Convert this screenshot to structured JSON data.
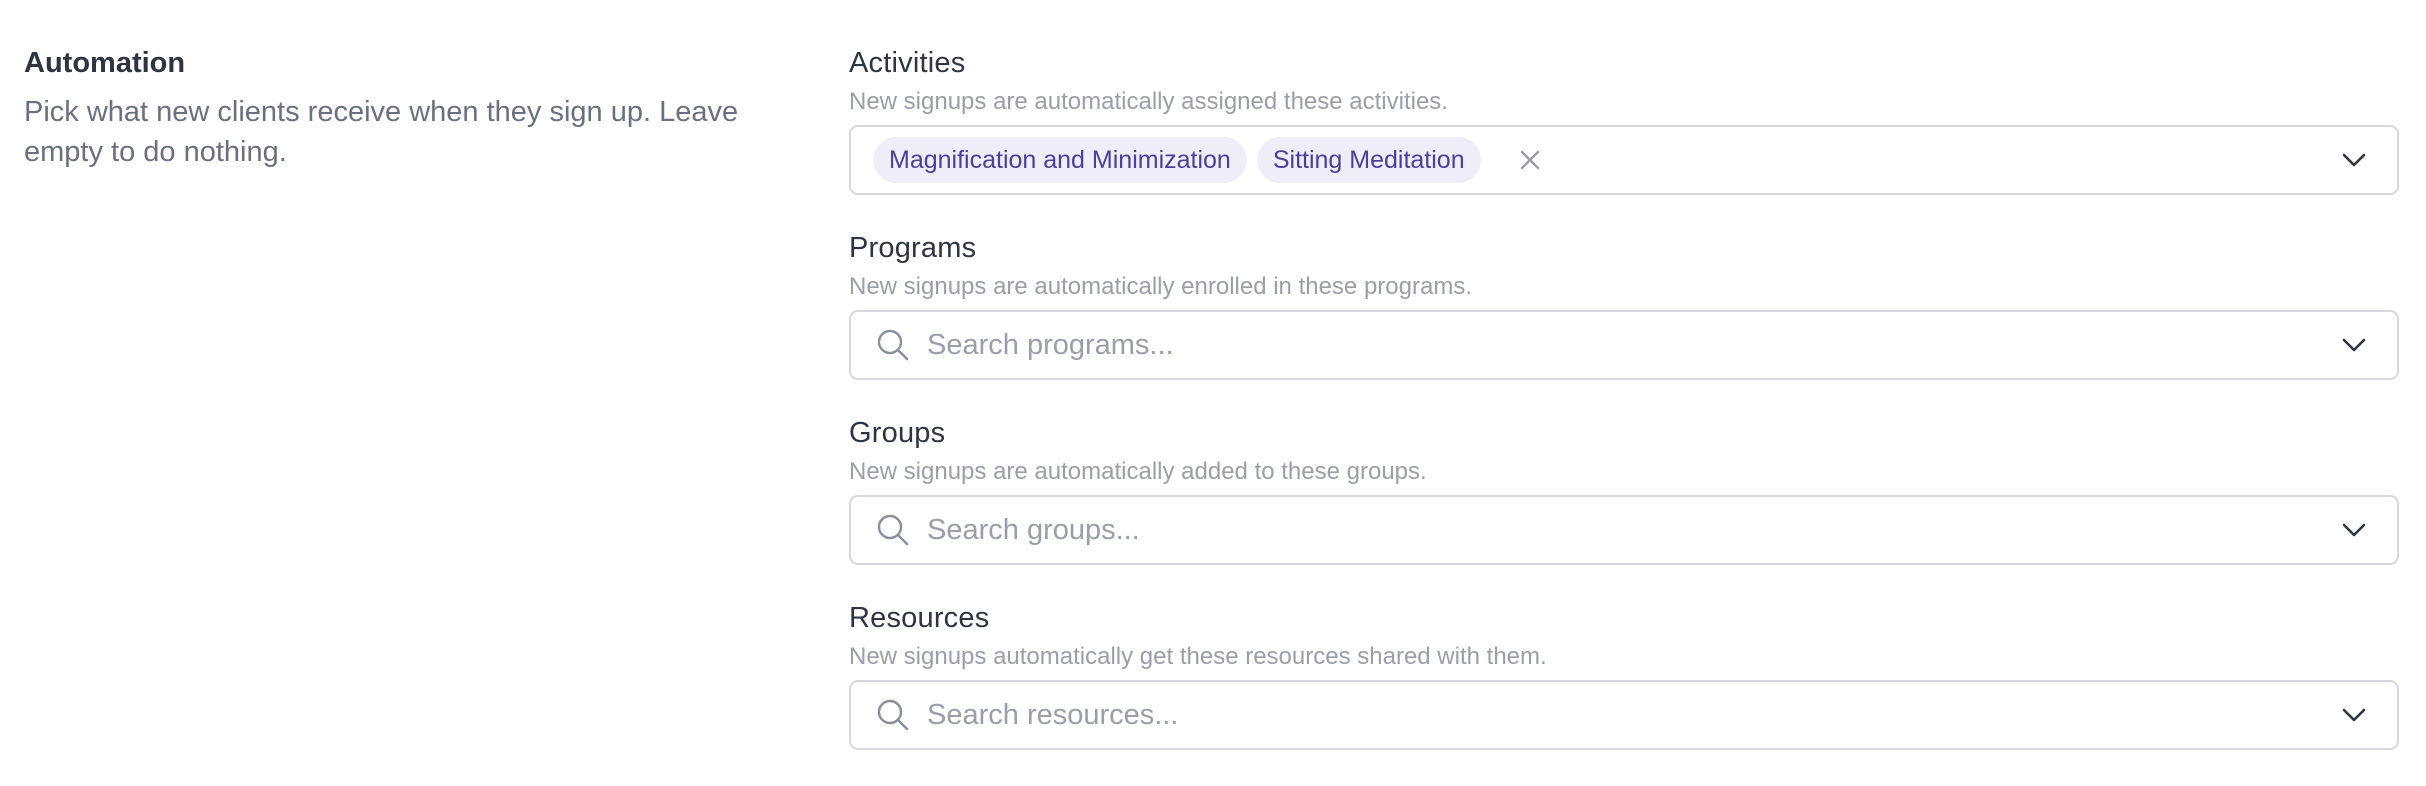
{
  "section": {
    "title": "Automation",
    "description": "Pick what new clients receive when they sign up. Leave empty to do nothing."
  },
  "fields": {
    "activities": {
      "label": "Activities",
      "help": "New signups are automatically assigned these activities.",
      "selected": [
        "Magnification and Minimization",
        "Sitting Meditation"
      ],
      "icon": "chevron-down-icon"
    },
    "programs": {
      "label": "Programs",
      "help": "New signups are automatically enrolled in these programs.",
      "placeholder": "Search programs...",
      "value": ""
    },
    "groups": {
      "label": "Groups",
      "help": "New signups are automatically added to these groups.",
      "placeholder": "Search groups...",
      "value": ""
    },
    "resources": {
      "label": "Resources",
      "help": "New signups automatically get these resources shared with them.",
      "placeholder": "Search resources...",
      "value": ""
    }
  },
  "colors": {
    "tag_bg": "#eeedf8",
    "tag_text": "#4a3f9a",
    "border": "#d6d8dd",
    "muted_text": "#9a9ea9"
  }
}
